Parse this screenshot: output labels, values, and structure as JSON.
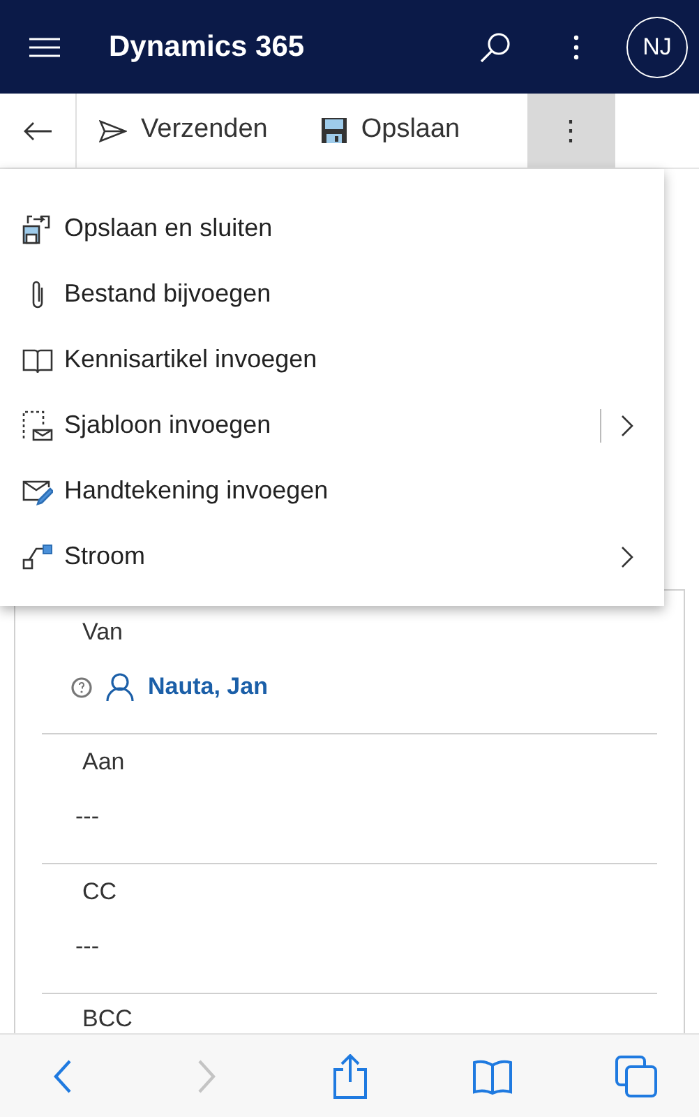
{
  "header": {
    "title": "Dynamics 365",
    "avatar": "NJ"
  },
  "command_bar": {
    "items": [
      {
        "label": "Verzenden",
        "kind": "send"
      },
      {
        "label": "Opslaan",
        "kind": "save"
      },
      {
        "label": "⋮",
        "kind": "more",
        "expanded": true
      }
    ]
  },
  "menu": {
    "items": [
      {
        "label": "Opslaan en sluiten",
        "submenu": false,
        "split": false
      },
      {
        "label": "Bestand bijvoegen",
        "submenu": false,
        "split": false
      },
      {
        "label": "Kennisartikel invoegen",
        "submenu": false,
        "split": false
      },
      {
        "label": "Sjabloon invoegen",
        "submenu": true,
        "split": true
      },
      {
        "label": "Handtekening invoegen",
        "submenu": false,
        "split": false
      },
      {
        "label": "Stroom",
        "submenu": true,
        "split": false
      }
    ]
  },
  "form": {
    "fields": [
      {
        "label": "Van",
        "kind": "lookup",
        "value": "Nauta, Jan"
      },
      {
        "label": "Aan",
        "kind": "empty",
        "value": "---"
      },
      {
        "label": "CC",
        "kind": "empty",
        "value": "---"
      },
      {
        "label": "BCC",
        "kind": "label_only"
      }
    ]
  },
  "browser_toolbar": {
    "buttons": [
      {
        "kind": "back",
        "disabled": false
      },
      {
        "kind": "forward",
        "disabled": true
      },
      {
        "kind": "share",
        "disabled": false
      },
      {
        "kind": "bookmarks",
        "disabled": false
      },
      {
        "kind": "tabs",
        "disabled": false
      }
    ]
  }
}
